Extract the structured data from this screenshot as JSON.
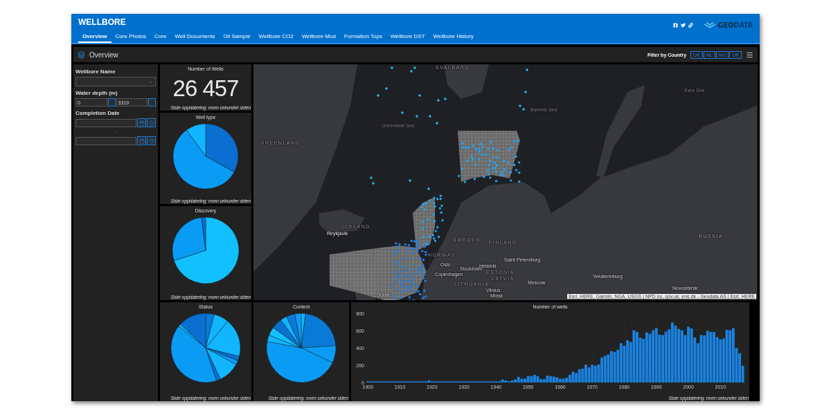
{
  "header": {
    "title": "WELLBORE",
    "tabs": [
      {
        "label": "Overview",
        "selected": true
      },
      {
        "label": "Core Photos",
        "selected": false
      },
      {
        "label": "Core",
        "selected": false
      },
      {
        "label": "Well Documents",
        "selected": false
      },
      {
        "label": "Oil Sample",
        "selected": false
      },
      {
        "label": "Wellbore CO2",
        "selected": false
      },
      {
        "label": "Wellbore Mud",
        "selected": false
      },
      {
        "label": "Formation Tops",
        "selected": false
      },
      {
        "label": "Wellbore DST",
        "selected": false
      },
      {
        "label": "Wellbore History",
        "selected": false
      }
    ],
    "logo": {
      "parts": [
        "GEO",
        "DATA"
      ]
    }
  },
  "toolbar": {
    "title": "Overview",
    "filter_label": "Filter by Country",
    "countries": [
      "DK",
      "NL",
      "NO",
      "UK"
    ]
  },
  "filters": {
    "wellbore_name": {
      "label": "Wellbore Name"
    },
    "water_depth": {
      "label": "Water depth (m)",
      "min": "0",
      "max": "3319"
    },
    "completion_date": {
      "label": "Completion Date",
      "separator": "-"
    }
  },
  "number_of_wells": {
    "title": "Number of Wells",
    "value": "26 457",
    "footer": "Siste oppdatering: noen sekunder siden"
  },
  "well_type": {
    "title": "Well type",
    "footer": "Siste oppdatering: noen sekunder siden"
  },
  "discovery": {
    "title": "Discovery",
    "footer": "Siste oppdatering: noen sekunder siden"
  },
  "status": {
    "title": "Status",
    "footer": "Siste oppdatering: noen sekunder siden"
  },
  "content": {
    "title": "Content",
    "footer": "Siste oppdatering: noen sekunder siden"
  },
  "map": {
    "labels": [
      "SVALBARD",
      "Kara Sea",
      "Barents Sea",
      "Greenland Sea",
      "GREENLAND",
      "ICELAND",
      "Reykjavík",
      "SWEDEN",
      "FINLAND",
      "NORWAY",
      "Oslo",
      "Stockholm",
      "Helsinki",
      "Saint Petersburg",
      "ESTONIA",
      "LATVIA",
      "LITHUANIA",
      "Vilnius",
      "Moscow",
      "Minsk",
      "Yekaterinburg",
      "Novosibirsk",
      "RUSSIA",
      "Copenhagen",
      "Dublin"
    ],
    "attribution": "Esri, HERE, Garmin, NGA, USGS | NPD.no, gov.uk, ens.dk - Geodata AS | Esri, HERE"
  },
  "wells_chart": {
    "footer": "Siste oppdatering: noen sekunder siden",
    "chart_data": {
      "type": "bar",
      "title": "Number of wells",
      "x": [
        1900,
        1901,
        1902,
        1903,
        1904,
        1905,
        1906,
        1907,
        1908,
        1909,
        1910,
        1911,
        1912,
        1913,
        1914,
        1915,
        1916,
        1917,
        1918,
        1919,
        1920,
        1921,
        1922,
        1923,
        1924,
        1925,
        1926,
        1927,
        1928,
        1929,
        1930,
        1931,
        1932,
        1933,
        1934,
        1935,
        1936,
        1937,
        1938,
        1939,
        1940,
        1941,
        1942,
        1943,
        1944,
        1945,
        1946,
        1947,
        1948,
        1949,
        1950,
        1951,
        1952,
        1953,
        1954,
        1955,
        1956,
        1957,
        1958,
        1959,
        1960,
        1961,
        1962,
        1963,
        1964,
        1965,
        1966,
        1967,
        1968,
        1969,
        1970,
        1971,
        1972,
        1973,
        1974,
        1975,
        1976,
        1977,
        1978,
        1979,
        1980,
        1981,
        1982,
        1983,
        1984,
        1985,
        1986,
        1987,
        1988,
        1989,
        1990,
        1991,
        1992,
        1993,
        1994,
        1995,
        1996,
        1997,
        1998,
        1999,
        2000,
        2001,
        2002,
        2003,
        2004,
        2005,
        2006,
        2007,
        2008,
        2009,
        2010,
        2011,
        2012,
        2013,
        2014,
        2015,
        2016,
        2017
      ],
      "values": [
        10,
        10,
        10,
        10,
        10,
        10,
        10,
        10,
        10,
        10,
        10,
        10,
        10,
        10,
        10,
        10,
        10,
        10,
        10,
        20,
        10,
        10,
        10,
        10,
        10,
        10,
        10,
        10,
        10,
        10,
        10,
        10,
        10,
        10,
        10,
        10,
        10,
        10,
        10,
        10,
        10,
        10,
        30,
        20,
        10,
        20,
        30,
        60,
        40,
        40,
        70,
        70,
        85,
        70,
        35,
        35,
        75,
        70,
        65,
        55,
        40,
        40,
        50,
        85,
        120,
        105,
        150,
        155,
        200,
        170,
        200,
        190,
        205,
        285,
        305,
        320,
        360,
        350,
        375,
        450,
        420,
        485,
        465,
        600,
        580,
        515,
        500,
        575,
        560,
        600,
        625,
        550,
        545,
        585,
        610,
        690,
        655,
        615,
        600,
        545,
        640,
        620,
        515,
        450,
        545,
        540,
        595,
        580,
        580,
        520,
        495,
        505,
        605,
        600,
        625,
        395,
        335,
        190
      ],
      "xlim": [
        1899.5,
        2017.5
      ],
      "ylim": [
        0,
        800
      ],
      "grid": true,
      "xticks": [
        1900,
        1910,
        1920,
        1930,
        1940,
        1950,
        1960,
        1970,
        1980,
        1990,
        2000,
        2010
      ],
      "yticks": [
        0,
        200,
        400,
        600,
        800
      ]
    }
  }
}
